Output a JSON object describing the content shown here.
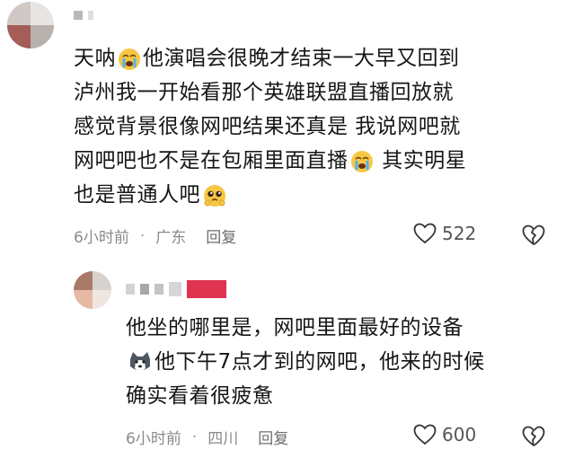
{
  "comment": {
    "text_lines": [
      "天呐",
      "他演唱会很晚才结束一大早又回到",
      "泸州我一开始看那个英雄联盟直播回放就",
      "感觉背景很像网吧结果还真是 我说网吧就",
      "网吧吧也不是在包厢里面直播",
      " 其实明星",
      "也是普通人吧"
    ],
    "emoji": [
      "crying-face",
      "crying-face",
      "pleading-face"
    ],
    "time": "6小时前",
    "location": "广东",
    "reply_label": "回复",
    "likes": "522"
  },
  "reply": {
    "text_lines": [
      "他坐的哪里是，网吧里面最好的设备",
      "他下午7点才到的网吧，他来的时候",
      "确实看着很疲惫"
    ],
    "emoji": [
      "husky-dog-face"
    ],
    "time": "6小时前",
    "location": "四川",
    "reply_label": "回复",
    "likes": "600"
  },
  "separator": "·",
  "colors": {
    "text": "#161616",
    "meta": "#8a8a8a",
    "mosaic_red": "#e0334f"
  }
}
